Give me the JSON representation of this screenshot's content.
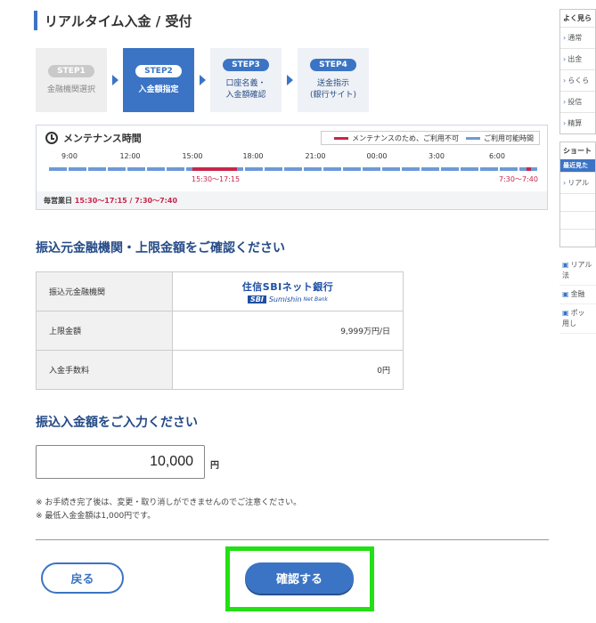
{
  "page": {
    "title": "リアルタイム入金 / 受付"
  },
  "steps": [
    {
      "pill": "STEP1",
      "label": "金融機関選択",
      "state": "done"
    },
    {
      "pill": "STEP2",
      "label": "入金額指定",
      "state": "active"
    },
    {
      "pill": "STEP3",
      "label": "口座名義・\n入金額確認",
      "state": "todo"
    },
    {
      "pill": "STEP4",
      "label": "送金指示\n(銀行サイト)",
      "state": "todo"
    }
  ],
  "maintenance": {
    "title": "メンテナンス時間",
    "legend_maint": "メンテナンスのため、ご利用不可",
    "legend_ok": "ご利用可能時間",
    "ticks": [
      "9:00",
      "12:00",
      "15:00",
      "18:00",
      "21:00",
      "00:00",
      "3:00",
      "6:00"
    ],
    "range1": "15:30〜17:15",
    "range2": "7:30〜7:40",
    "footer_label": "毎営業日",
    "footer_times": "15:30〜17:15 / 7:30〜7:40",
    "colors": {
      "maint": "#c8264a",
      "ok": "#6c9bd6"
    }
  },
  "confirm_section": {
    "heading": "振込元金融機関・上限金額をご確認ください",
    "rows": [
      {
        "key": "振込元金融機関",
        "value": ""
      },
      {
        "key": "上限金額",
        "value": "9,999万円/日"
      },
      {
        "key": "入金手数料",
        "value": "0円"
      }
    ],
    "bank_logo": {
      "jp": "住信SBIネット銀行",
      "sbi": "SBI",
      "sumishin": "Sumishin",
      "netbank": "Net Bank"
    }
  },
  "amount_section": {
    "heading": "振込入金額をご入力ください",
    "value": "10,000",
    "unit": "円",
    "notes": [
      "※ お手続き完了後は、変更・取り消しができませんのでご注意ください。",
      "※ 最低入金金額は1,000円です。"
    ]
  },
  "buttons": {
    "back": "戻る",
    "confirm": "確認する"
  },
  "sidebar": {
    "head": "よく見ら",
    "items": [
      "通常",
      "出金",
      "らくら",
      "投信",
      "精算"
    ],
    "shortcut_head": "ショート",
    "recent": "最近見た",
    "recent_item": "リアル",
    "links": [
      {
        "l1": "リアル",
        "l2": "法"
      },
      {
        "l1": "金融",
        "l2": ""
      },
      {
        "l1": "ポッ",
        "l2": "用し"
      }
    ]
  },
  "colors": {
    "accent": "#3b74c4",
    "highlight": "#22e014"
  }
}
